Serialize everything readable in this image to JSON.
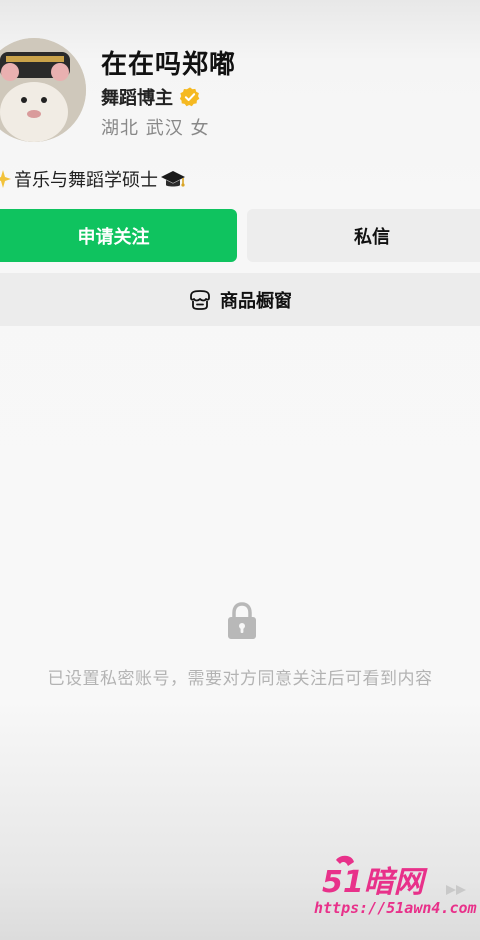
{
  "profile": {
    "name": "在在吗郑嘟",
    "role": "舞蹈博主",
    "location": "湖北 武汉 女",
    "bio": "音乐与舞蹈学硕士",
    "verified_color": "#f5b921"
  },
  "actions": {
    "follow_label": "申请关注",
    "message_label": "私信",
    "follow_color": "#0fc35f"
  },
  "shop": {
    "label": "商品橱窗",
    "icon": "shop-window-icon"
  },
  "private_notice": {
    "text": "已设置私密账号，需要对方同意关注后可看到内容",
    "icon": "lock-icon"
  },
  "watermark": {
    "logo_text": "51暗网",
    "url": "https://51awn4.com"
  }
}
